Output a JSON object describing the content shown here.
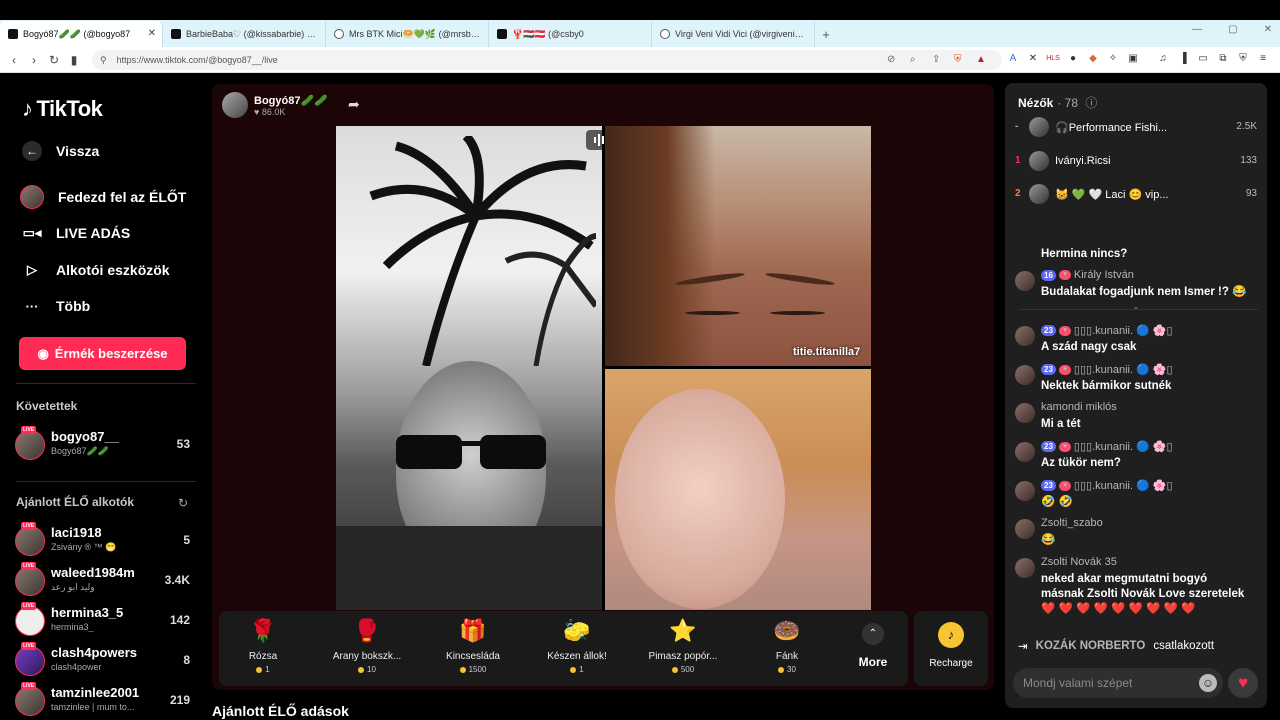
{
  "browser": {
    "tabs": [
      {
        "title": "Bogyó87🥒🥒 (@bogyo87"
      },
      {
        "title": "BarbieBaba♡ (@kissabarbie) ÉLŐ a"
      },
      {
        "title": "Mrs BTK Mici🥯💚🌿 (@mrsbtk)"
      },
      {
        "title": "🦞🇭🇺🇦🇹 (@csby0"
      },
      {
        "title": "Virgi Veni Vidi Vici (@virgivenividivic"
      }
    ],
    "url": "https://www.tiktok.com/@bogyo87__/live"
  },
  "brand": {
    "name": "TikTok",
    "accent": "#fe2c55"
  },
  "sidebar": {
    "back": "Vissza",
    "nav": [
      {
        "label": "Fedezd fel az ÉLŐT"
      },
      {
        "label": "LIVE ADÁS"
      },
      {
        "label": "Alkotói eszközök"
      },
      {
        "label": "Több"
      }
    ],
    "coin_button": "Érmék beszerzése",
    "following_title": "Követettek",
    "following": [
      {
        "username": "bogyo87__",
        "display": "Bogyó87🥒🥒",
        "count": "53"
      }
    ],
    "suggested_title": "Ajánlott ÉLŐ alkotók",
    "suggested": [
      {
        "username": "laci1918",
        "display": "Zsivány ® ™ 😁",
        "count": "5"
      },
      {
        "username": "waleed1984m",
        "display": "وليد ابو رعد",
        "count": "3.4K"
      },
      {
        "username": "hermina3_5",
        "display": "hermina3_",
        "count": "142"
      },
      {
        "username": "clash4powers",
        "display": "clash4power",
        "count": "8"
      },
      {
        "username": "tamzinlee2001",
        "display": "tamzinlee | mum to...",
        "count": "219"
      }
    ],
    "live_badge": "LIVE"
  },
  "stream": {
    "host_name": "Bogyó87🥒🥒",
    "host_likes": "♥ 86.0K",
    "guest_name": "titie.titanilla7",
    "below_title": "Ajánlott ÉLŐ adások"
  },
  "gifts": [
    {
      "name": "Rózsa",
      "price": "1",
      "icon": "🌹"
    },
    {
      "name": "Arany bokszk...",
      "price": "10",
      "icon": "🥊"
    },
    {
      "name": "Kincsesláda",
      "price": "1500",
      "icon": "🎁"
    },
    {
      "name": "Készen állok!",
      "price": "1",
      "icon": "🧽"
    },
    {
      "name": "Pimasz popór...",
      "price": "500",
      "icon": "⭐"
    },
    {
      "name": "Fánk",
      "price": "30",
      "icon": "🍩"
    }
  ],
  "gift_more": "More",
  "recharge": "Recharge",
  "viewers": {
    "title": "Nézők",
    "count": "· 78",
    "list": [
      {
        "rank": "-",
        "name": "🎧Performance Fishi...",
        "score": "2.5K"
      },
      {
        "rank": "1",
        "name": "Iványi.Ricsi",
        "score": "133"
      },
      {
        "rank": "2",
        "name": "😸 💚 🤍 Laci 😊 vip...",
        "score": "93"
      }
    ]
  },
  "chat": [
    {
      "user": "",
      "level": "",
      "text": "Hermina nincs?"
    },
    {
      "user": "Király István",
      "level": "16",
      "text": "Budalakat fogadjunk nem Ismer !? 😂"
    },
    {
      "user": "▯▯▯.kunanii. 🔵 🌸▯",
      "level": "23",
      "text": "A szád nagy csak"
    },
    {
      "user": "▯▯▯.kunanii. 🔵 🌸▯",
      "level": "23",
      "text": "Nektek bármikor sutnék"
    },
    {
      "user": "kamondi miklós",
      "level": "",
      "text": "Mi a tét"
    },
    {
      "user": "▯▯▯.kunanii. 🔵 🌸▯",
      "level": "23",
      "text": "Az tükör nem?"
    },
    {
      "user": "▯▯▯.kunanii. 🔵 🌸▯",
      "level": "23",
      "text": "🤣 🤣"
    },
    {
      "user": "Zsolti_szabo",
      "level": "",
      "text": "😂"
    },
    {
      "user": "Zsolti Novák 35",
      "level": "",
      "text": "neked akar megmutatni bogyó másnak Zsolti Novák Love szeretelek ❤️ ❤️ ❤️ ❤️ ❤️ ❤️ ❤️ ❤️ ❤️"
    }
  ],
  "join_notice": {
    "user": "KOZÁK NORBERTO",
    "text": "csatlakozott"
  },
  "chat_input_placeholder": "Mondj valami szépet"
}
